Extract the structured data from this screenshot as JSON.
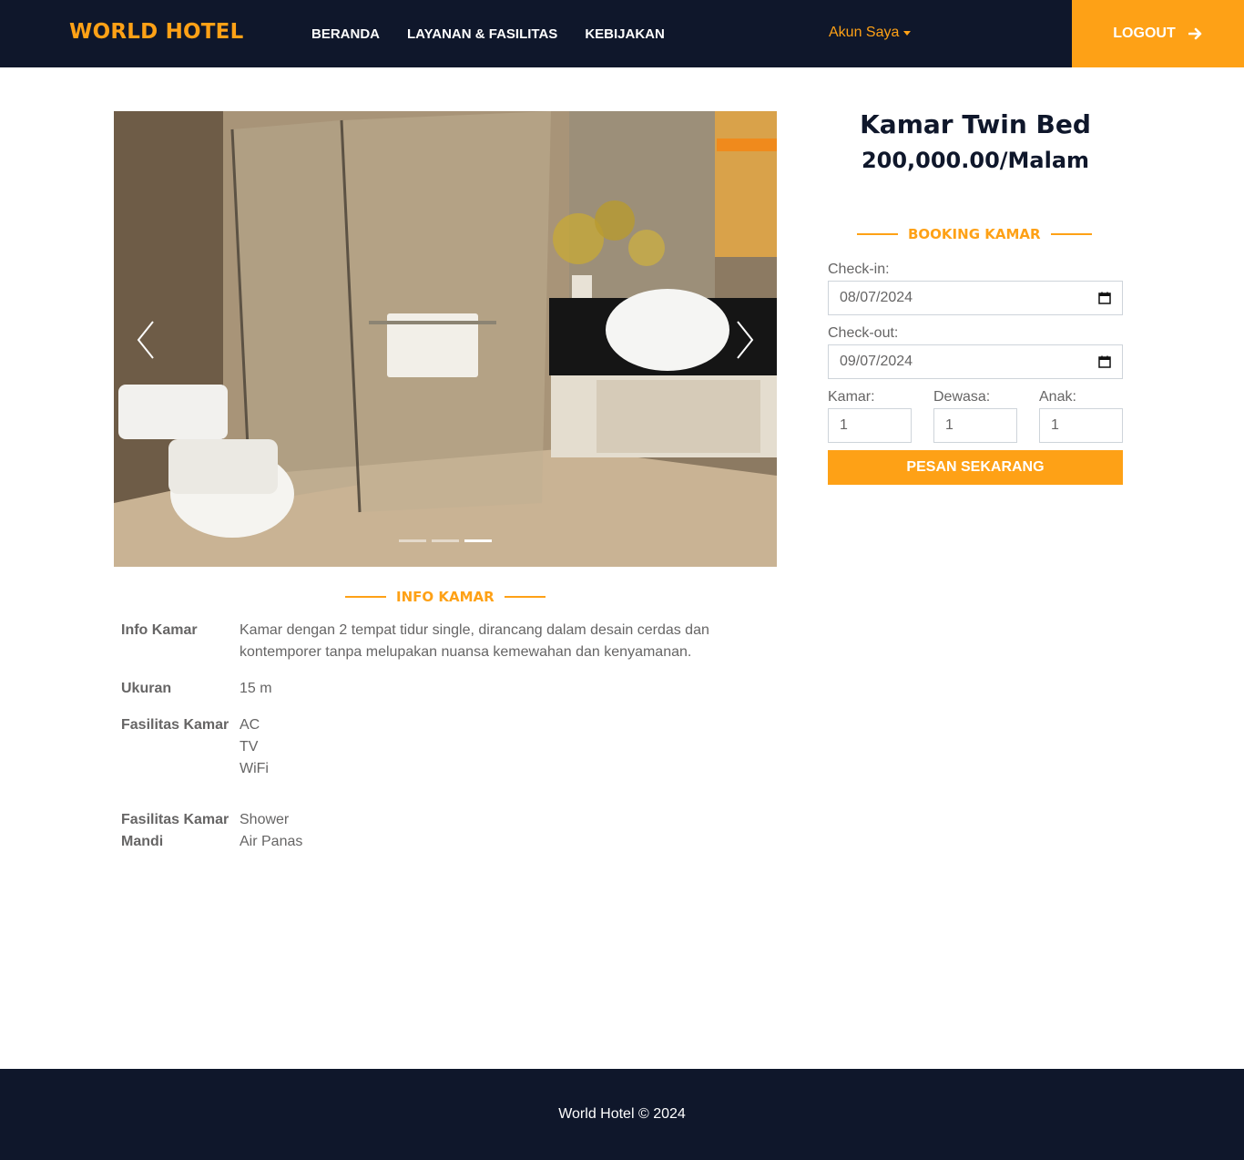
{
  "navbar": {
    "brand": "WORLD HOTEL",
    "links": [
      "BERANDA",
      "LAYANAN & FASILITAS",
      "KEBIJAKAN"
    ],
    "account": "Akun Saya",
    "logout": "LOGOUT",
    "colors": {
      "background": "#0f172b",
      "accent": "#fea116"
    }
  },
  "carousel": {
    "image_icon": "bathroom-photo",
    "slide_count": 3,
    "active_index": 2,
    "prev_icon": "chevron-left-icon",
    "next_icon": "chevron-right-icon"
  },
  "room": {
    "title": "Kamar Twin Bed",
    "price": "200,000.00/Malam"
  },
  "booking": {
    "section_title": "BOOKING KAMAR",
    "checkin_label": "Check-in:",
    "checkin_value": "08/07/2024",
    "checkout_label": "Check-out:",
    "checkout_value": "09/07/2024",
    "kamar_label": "Kamar:",
    "kamar_value": "1",
    "dewasa_label": "Dewasa:",
    "dewasa_value": "1",
    "anak_label": "Anak:",
    "anak_value": "1",
    "submit": "PESAN SEKARANG"
  },
  "info": {
    "section_title": "INFO KAMAR",
    "rows": [
      {
        "key": "Info Kamar",
        "values": [
          "Kamar dengan 2 tempat tidur single, dirancang dalam desain cerdas dan kontemporer tanpa melupakan nuansa kemewahan dan kenyamanan."
        ]
      },
      {
        "key": "Ukuran",
        "values": [
          "15 m"
        ]
      },
      {
        "key": "Fasilitas Kamar",
        "values": [
          "AC",
          "TV",
          "WiFi"
        ]
      },
      {
        "key": "Fasilitas Kamar Mandi",
        "values": [
          "Shower",
          "Air Panas"
        ]
      }
    ]
  },
  "footer": {
    "text": "World Hotel © 2024"
  }
}
